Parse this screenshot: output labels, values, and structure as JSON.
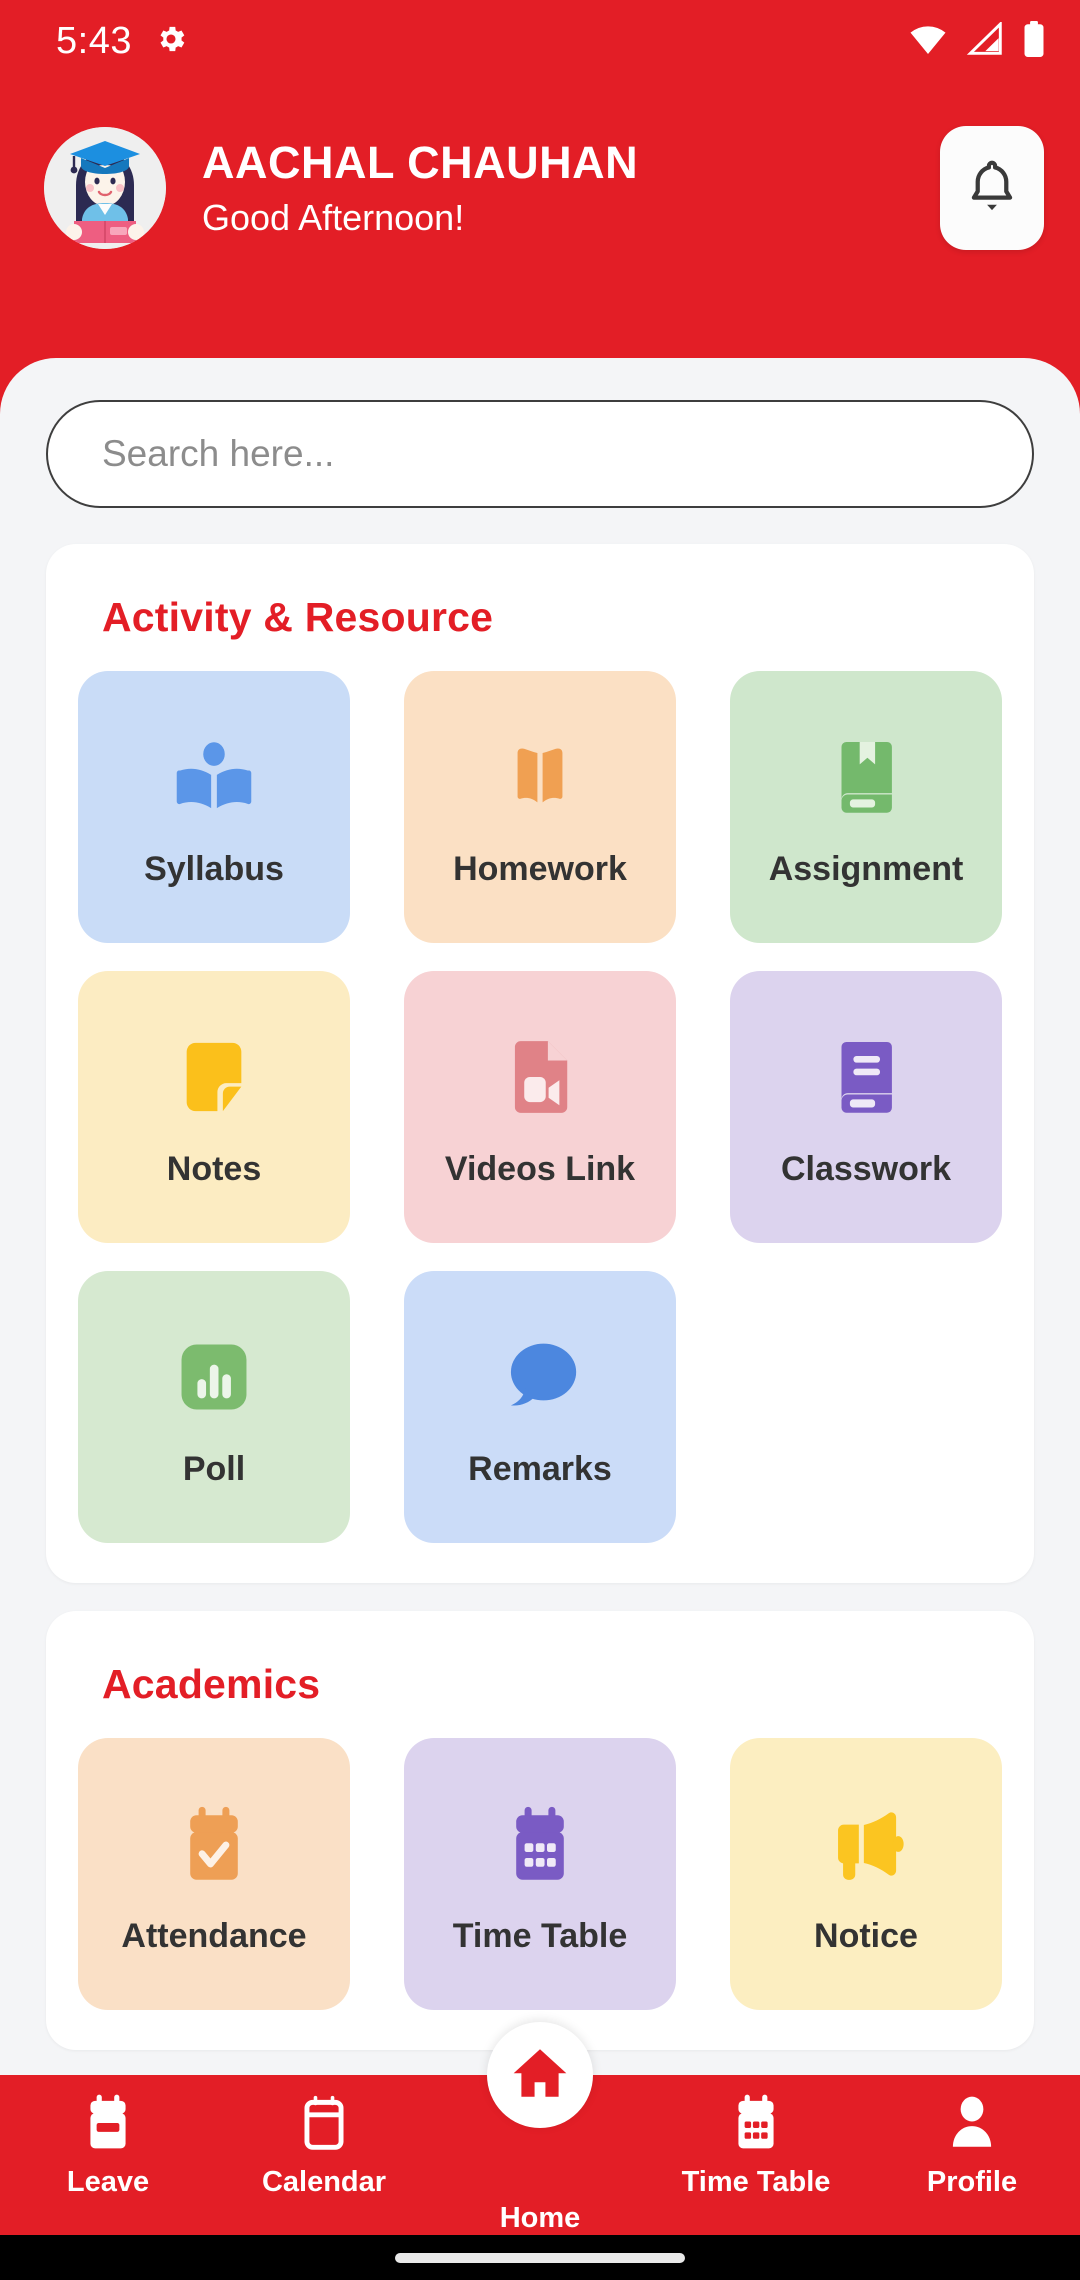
{
  "status_bar": {
    "time": "5:43",
    "icons": [
      "settings-gear-icon",
      "wifi-icon",
      "cellular-signal-icon",
      "battery-icon"
    ]
  },
  "header": {
    "user_name": "AACHAL CHAUHAN",
    "greeting": "Good Afternoon!",
    "avatar_icon": "student-avatar",
    "notification_icon": "bell-icon"
  },
  "search": {
    "value": "",
    "placeholder": "Search here..."
  },
  "sections": [
    {
      "title": "Activity & Resource",
      "tiles": [
        {
          "label": "Syllabus",
          "icon": "open-book-reader-icon",
          "bg": "#C9DCF7",
          "fg": "#5B96E8"
        },
        {
          "label": "Homework",
          "icon": "open-book-icon",
          "bg": "#FBE0C4",
          "fg": "#F0A052"
        },
        {
          "label": "Assignment",
          "icon": "bookmark-book-icon",
          "bg": "#CFE7CC",
          "fg": "#74B96C"
        },
        {
          "label": "Notes",
          "icon": "note-page-icon",
          "bg": "#FCECC2",
          "fg": "#FBC01B"
        },
        {
          "label": "Videos Link",
          "icon": "video-file-icon",
          "bg": "#F7D2D4",
          "fg": "#E08287"
        },
        {
          "label": "Classwork",
          "icon": "notebook-icon",
          "bg": "#DCD3EE",
          "fg": "#7A5BC4"
        },
        {
          "label": "Poll",
          "icon": "bar-chart-icon",
          "bg": "#D6E9D0",
          "fg": "#7CBB6E"
        },
        {
          "label": "Remarks",
          "icon": "chat-bubble-icon",
          "bg": "#CBDCF8",
          "fg": "#4C87DF"
        }
      ]
    },
    {
      "title": "Academics",
      "tiles": [
        {
          "label": "Attendance",
          "icon": "calendar-check-icon",
          "bg": "#FAE0C6",
          "fg": "#EE9F55"
        },
        {
          "label": "Time Table",
          "icon": "calendar-grid-icon",
          "bg": "#DCD3EE",
          "fg": "#7A5BC4"
        },
        {
          "label": "Notice",
          "icon": "megaphone-icon",
          "bg": "#FCEEC1",
          "fg": "#FBC521"
        }
      ]
    }
  ],
  "bottom_nav": {
    "items": [
      {
        "label": "Leave",
        "icon": "calendar-leave-icon",
        "active": false
      },
      {
        "label": "Calendar",
        "icon": "calendar-icon",
        "active": false
      },
      {
        "label": "Home",
        "icon": "home-icon",
        "active": true
      },
      {
        "label": "Time Table",
        "icon": "calendar-grid-icon",
        "active": false
      },
      {
        "label": "Profile",
        "icon": "person-icon",
        "active": false
      }
    ]
  },
  "colors": {
    "brand_red": "#E31E26",
    "sheet_bg": "#F4F5F7",
    "card_bg": "#FFFFFF",
    "tile_label": "#333333"
  }
}
